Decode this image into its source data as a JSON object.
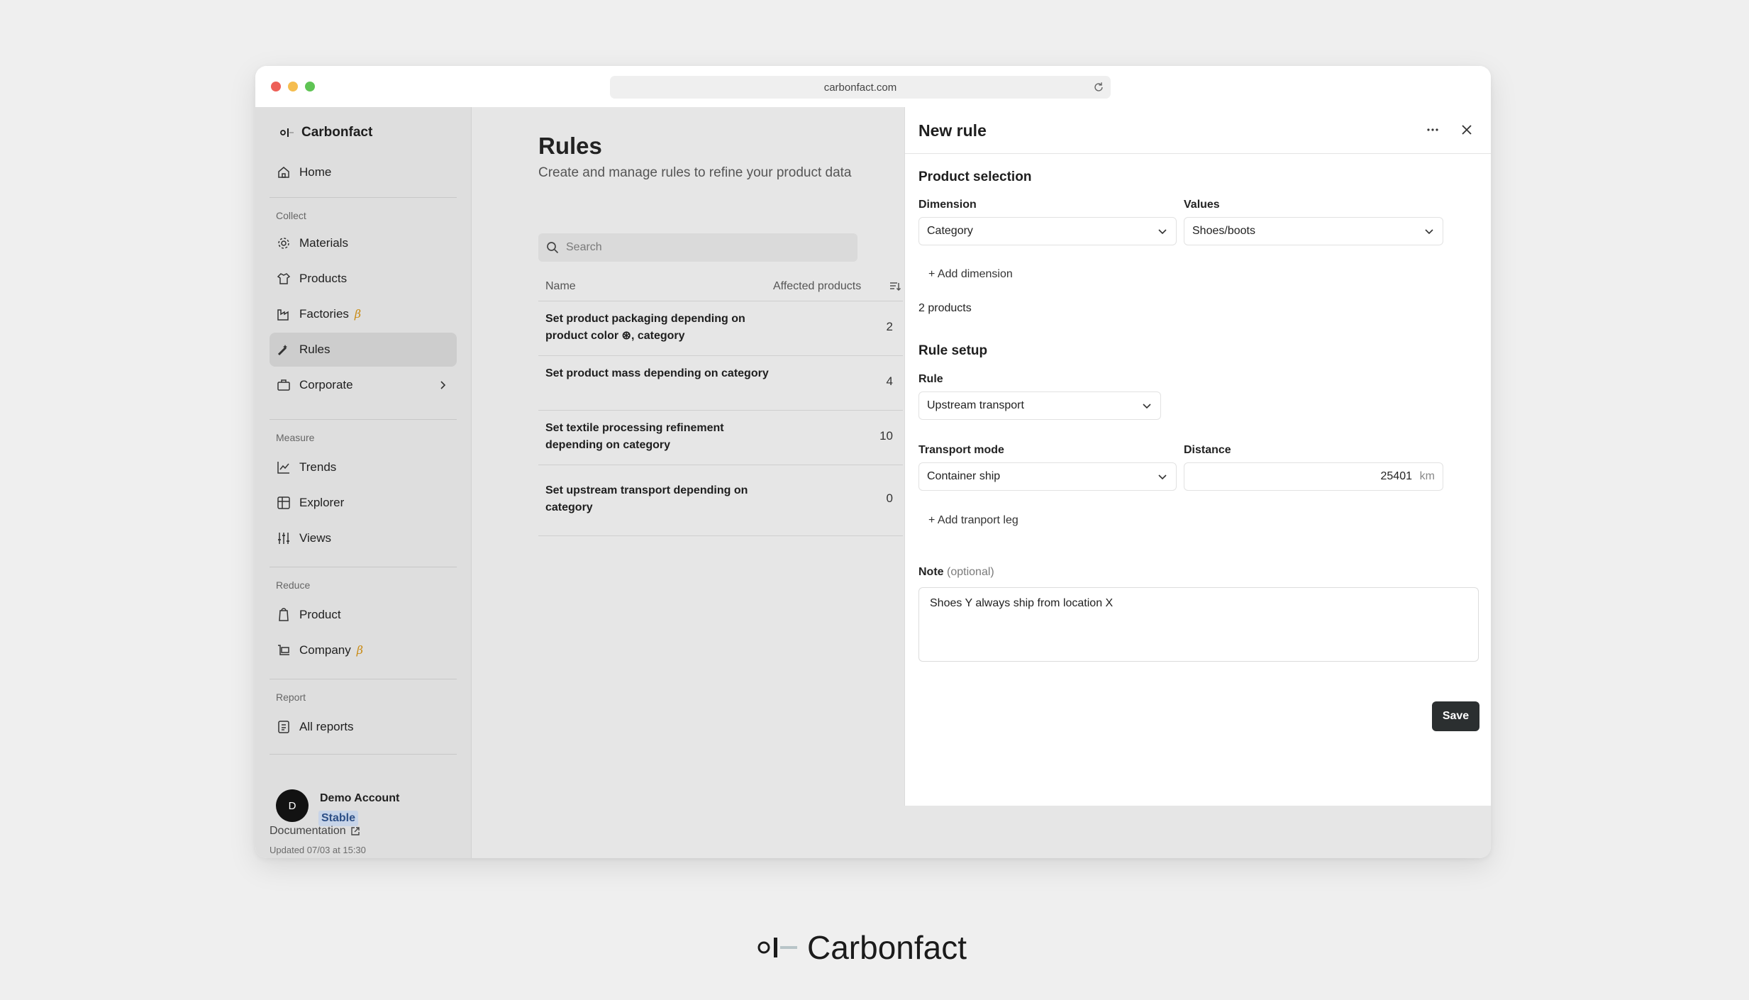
{
  "browser": {
    "url": "carbonfact.com"
  },
  "sidebar": {
    "brand": "Carbonfact",
    "home": "Home",
    "sections": {
      "collect": "Collect",
      "measure": "Measure",
      "reduce": "Reduce",
      "report": "Report"
    },
    "items": {
      "materials": "Materials",
      "products": "Products",
      "factories": "Factories",
      "rules": "Rules",
      "corporate": "Corporate",
      "trends": "Trends",
      "explorer": "Explorer",
      "views": "Views",
      "product": "Product",
      "company": "Company",
      "all_reports": "All reports"
    },
    "beta": "β",
    "account": {
      "initial": "D",
      "name": "Demo Account",
      "badge": "Stable"
    },
    "documentation": "Documentation",
    "updated": "Updated 07/03 at 15:30"
  },
  "main": {
    "title": "Rules",
    "subtitle": "Create and manage rules to refine your product data",
    "search_placeholder": "Search",
    "columns": {
      "name": "Name",
      "affected": "Affected products"
    },
    "rows": [
      {
        "name": "Set product packaging depending on product color ⊛, category",
        "count": "2"
      },
      {
        "name": "Set product mass depending on category",
        "count": "4"
      },
      {
        "name": "Set textile processing refinement depending on category",
        "count": "10"
      },
      {
        "name": "Set upstream transport depending on category",
        "count": "0"
      }
    ]
  },
  "panel": {
    "title": "New rule",
    "product_selection": "Product selection",
    "dimension_label": "Dimension",
    "dimension_value": "Category",
    "values_label": "Values",
    "values_value": "Shoes/boots",
    "add_dimension": "Add dimension",
    "products_count": "2 products",
    "rule_setup": "Rule setup",
    "rule_label": "Rule",
    "rule_value": "Upstream transport",
    "transport_label": "Transport mode",
    "transport_value": "Container ship",
    "distance_label": "Distance",
    "distance_value": "25401",
    "distance_unit": "km",
    "add_leg": "Add tranport leg",
    "note_label": "Note",
    "note_optional": "(optional)",
    "note_value": "Shoes Y always ship from location X",
    "save": "Save"
  },
  "footer_logo": "Carbonfact"
}
